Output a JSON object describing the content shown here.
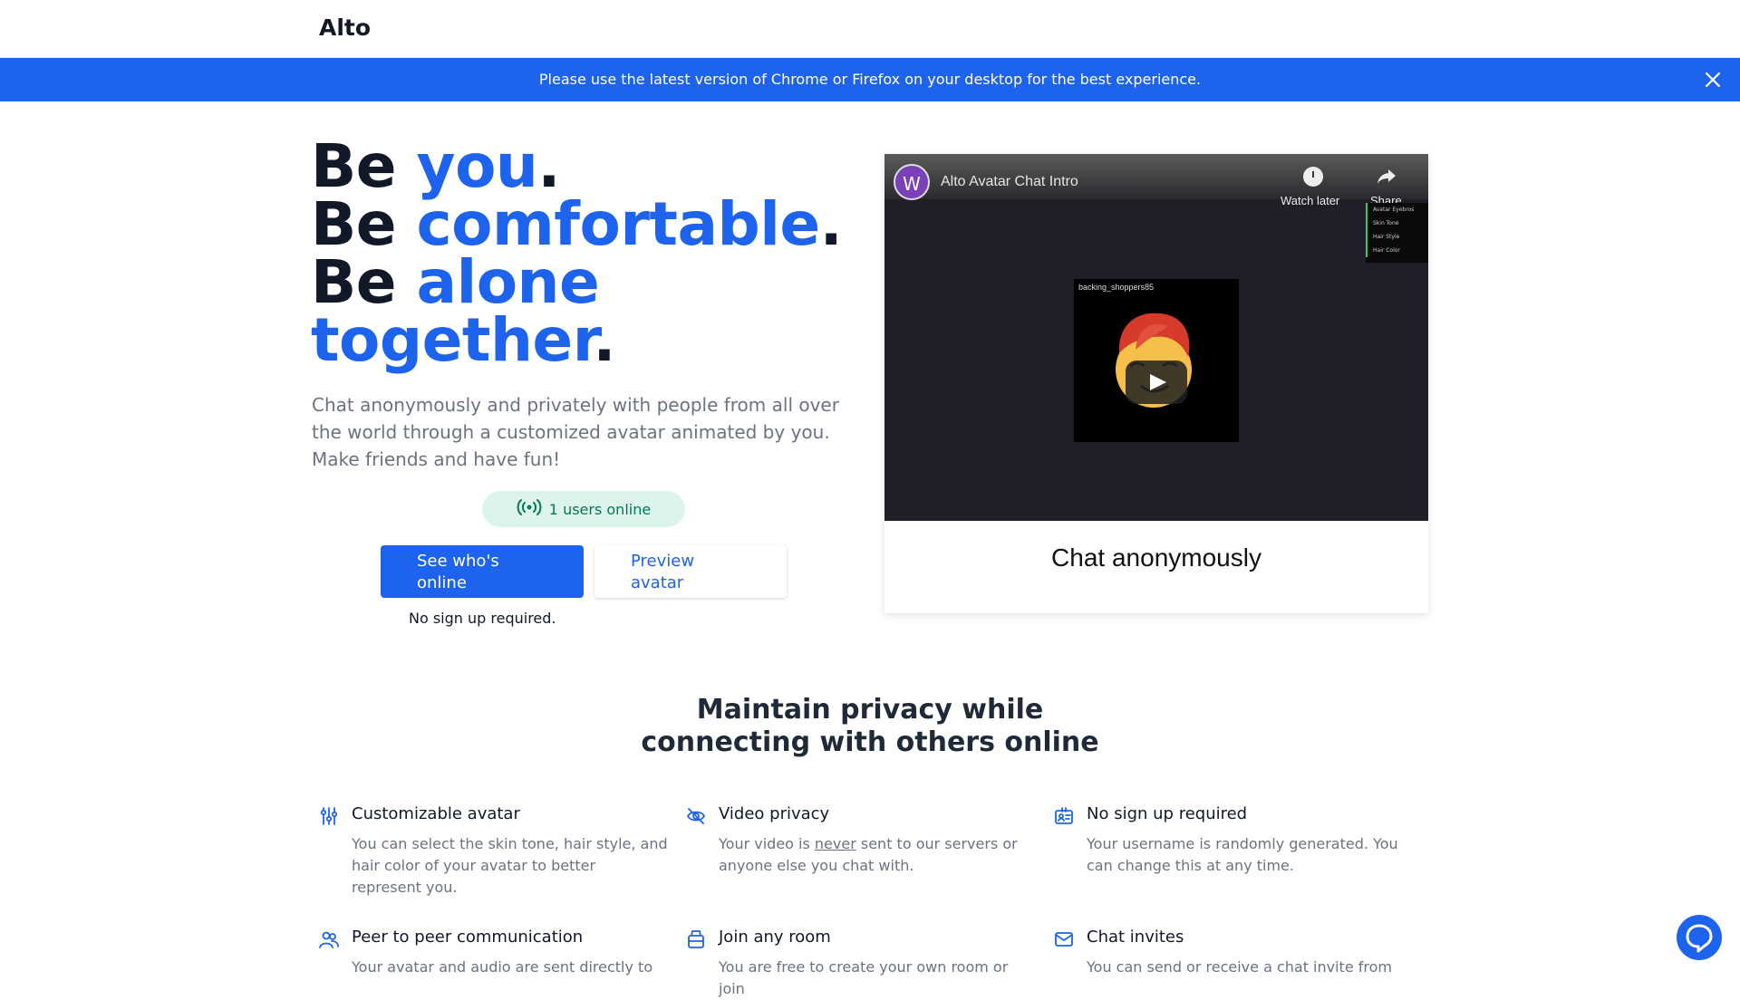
{
  "header": {
    "logo": "Alto"
  },
  "banner": {
    "text": "Please use the latest version of Chrome or Firefox on your desktop for the best experience."
  },
  "hero": {
    "line1_prefix": "Be ",
    "line1_highlight": "you",
    "line1_suffix": ".",
    "line2_prefix": "Be ",
    "line2_highlight": "comfortable",
    "line2_suffix": ".",
    "line3_prefix": "Be ",
    "line3_highlight": "alone",
    "line4_highlight": "together",
    "line4_suffix": ".",
    "subtitle": "Chat anonymously and privately with people from all over the world through a customized avatar animated by you. Make friends and have fun!",
    "online_count": "1 users online",
    "primary_button": "See who's online",
    "secondary_button": "Preview avatar",
    "note": "No sign up required."
  },
  "video": {
    "channel_initial": "W",
    "title": "Alto Avatar Chat Intro",
    "watch_later": "Watch later",
    "share": "Share",
    "menu_items": [
      "Avatar Eyebros",
      "Skin Tone",
      "Hair Style",
      "Hair Color"
    ],
    "feed_username": "backing_shoppers85",
    "caption": "Chat anonymously"
  },
  "section": {
    "title_line1": "Maintain privacy while",
    "title_line2": "connecting with others online"
  },
  "features": [
    {
      "icon": "sliders-icon",
      "title": "Customizable avatar",
      "text": "You can select the skin tone, hair style, and hair color of your avatar to better represent you."
    },
    {
      "icon": "eye-off-icon",
      "title": "Video privacy",
      "text_before": "Your video is ",
      "text_em": "never",
      "text_after": " sent to our servers or anyone else you chat with."
    },
    {
      "icon": "id-card-icon",
      "title": "No sign up required",
      "text": "Your username is randomly generated. You can change this at any time."
    },
    {
      "icon": "users-icon",
      "title": "Peer to peer communication",
      "text": "Your avatar and audio are sent directly to"
    },
    {
      "icon": "inbox-icon",
      "title": "Join any room",
      "text": "You are free to create your own room or join"
    },
    {
      "icon": "mail-icon",
      "title": "Chat invites",
      "text": "You can send or receive a chat invite from"
    }
  ],
  "colors": {
    "brand": "#1d63ed",
    "heading": "#111827",
    "muted": "#6b7280",
    "online_bg": "#dcf4ec",
    "online_text": "#047857"
  }
}
